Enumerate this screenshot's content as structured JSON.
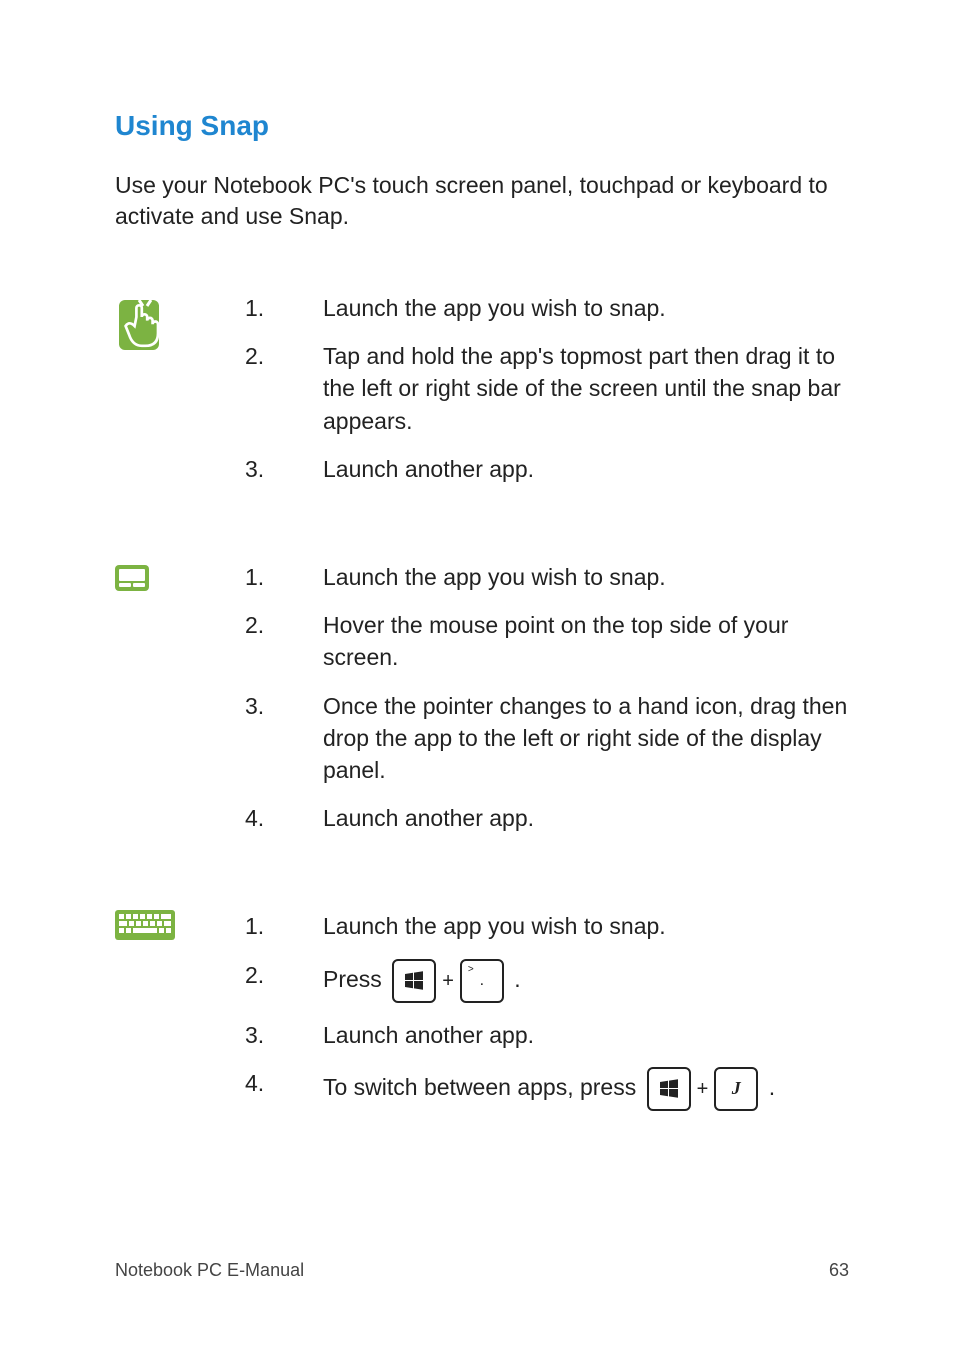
{
  "heading": "Using Snap",
  "intro": "Use your Notebook PC's touch screen panel, touchpad or keyboard to activate and use Snap.",
  "touch": {
    "steps": [
      "Launch the app you wish to snap.",
      "Tap and hold the app's topmost part then drag it to the left or right side of the screen until the snap bar appears.",
      "Launch another app."
    ]
  },
  "touchpad": {
    "steps": [
      "Launch the app you wish to snap.",
      "Hover the mouse point on the top side of your screen.",
      "Once the pointer changes to a hand icon, drag then drop the app to the left or right side of the display panel.",
      "Launch another app."
    ]
  },
  "keyboard": {
    "steps": {
      "s1": "Launch the app you wish to snap.",
      "s2_prefix": "Press ",
      "s2_suffix": ".",
      "s3": "Launch another app.",
      "s4_prefix": "To switch between apps, press ",
      "s4_suffix": "."
    },
    "keys": {
      "win": "win",
      "period": ".",
      "period_shift": ">",
      "j": "J"
    }
  },
  "footer": {
    "left": "Notebook PC E-Manual",
    "right": "63"
  }
}
